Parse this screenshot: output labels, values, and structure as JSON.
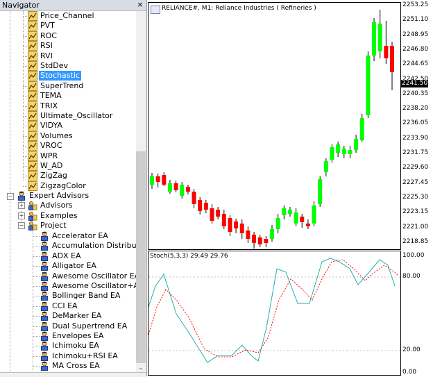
{
  "navigator": {
    "title": "Navigator",
    "close_glyph": "×",
    "indicators": [
      "Price_Channel",
      "PVT",
      "ROC",
      "RSI",
      "RVI",
      "StdDev",
      "Stochastic",
      "SuperTrend",
      "TEMA",
      "TRIX",
      "Ultimate_Oscillator",
      "VIDYA",
      "Volumes",
      "VROC",
      "WPR",
      "W_AD",
      "ZigZag",
      "ZigzagColor"
    ],
    "selected_indicator": "Stochastic",
    "expert_advisors_label": "Expert Advisors",
    "ea_folders": [
      "Advisors",
      "Examples",
      "Project"
    ],
    "project_items": [
      "Accelerator EA",
      "Accumulation Distribution E",
      "ADX EA",
      "Alligator EA",
      "Awesome Oscillator EA",
      "Awesome Oscillator+Alligat",
      "Bollinger Band EA",
      "CCI EA",
      "DeMarker EA",
      "Dual Supertrend EA",
      "Envelopes EA",
      "Ichimoku EA",
      "Ichimoku+RSI EA",
      "MA Cross EA"
    ]
  },
  "chart": {
    "symbol_line": "RELIANCE#, M1:  Reliance Industries ( Refineries )",
    "price_labels": [
      "2253.25",
      "2251.10",
      "2248.95",
      "2246.80",
      "2244.65",
      "2242.50",
      "2240.35",
      "2238.20",
      "2236.05",
      "2233.90",
      "2231.75",
      "2229.60",
      "2227.45",
      "2225.30",
      "2223.15",
      "2221.00",
      "2218.85"
    ],
    "current_price": "2241.50",
    "indicator_line": "Stoch(5,3,3) 29.49 29.76",
    "osc_labels": [
      "100.00",
      "80.00",
      "20.00",
      "0.00"
    ],
    "colors": {
      "bull": "#00ff00",
      "bear": "#ff0000",
      "main_line": "#20b2aa",
      "signal_line": "#ff0000"
    }
  }
}
